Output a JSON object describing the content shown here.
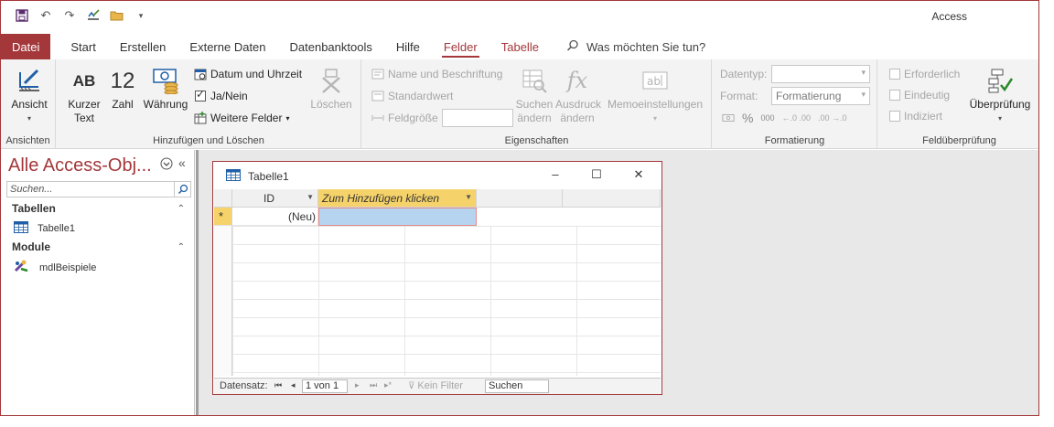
{
  "app": {
    "title": "Access"
  },
  "colors": {
    "accent": "#a4373a",
    "highlight_column": "#f6d36a",
    "selected_cell": "#b6d4f0"
  },
  "qat": {
    "icons": [
      "save-icon",
      "undo-icon",
      "redo-icon",
      "spelling-icon",
      "open-folder-icon",
      "customize-qat-icon"
    ]
  },
  "tabs": [
    {
      "label": "Datei"
    },
    {
      "label": "Start"
    },
    {
      "label": "Erstellen"
    },
    {
      "label": "Externe Daten"
    },
    {
      "label": "Datenbanktools"
    },
    {
      "label": "Hilfe"
    },
    {
      "label": "Felder"
    },
    {
      "label": "Tabelle"
    }
  ],
  "tellme": {
    "label": "Was möchten Sie tun?"
  },
  "ribbon": {
    "views": {
      "label": "Ansicht",
      "group": "Ansichten"
    },
    "add_delete": {
      "group": "Hinzufügen und Löschen",
      "short_text": "Kurzer Text",
      "short_text_icon": "AB",
      "number": "Zahl",
      "number_icon": "12",
      "currency": "Währung",
      "datetime": "Datum und Uhrzeit",
      "yesno": "Ja/Nein",
      "more_fields": "Weitere Felder",
      "delete": "Löschen"
    },
    "properties": {
      "group": "Eigenschaften",
      "name_caption": "Name und Beschriftung",
      "default_value": "Standardwert",
      "field_size": "Feldgröße",
      "lookups": "Suchen ändern",
      "expression": "Ausdruck ändern",
      "memo": "Memoeinstellungen"
    },
    "formatting": {
      "group": "Formatierung",
      "datatype_label": "Datentyp:",
      "format_label": "Format:",
      "format_value": "Formatierung",
      "percent": "%",
      "thousands": "000"
    },
    "validation": {
      "group": "Feldüberprüfung",
      "required": "Erforderlich",
      "unique": "Eindeutig",
      "indexed": "Indiziert",
      "validation": "Überprüfung"
    }
  },
  "nav": {
    "title": "Alle Access-Obj...",
    "search_placeholder": "Suchen...",
    "sections": [
      {
        "label": "Tabellen",
        "items": [
          {
            "label": "Tabelle1",
            "icon": "table-icon"
          }
        ]
      },
      {
        "label": "Module",
        "items": [
          {
            "label": "mdlBeispiele",
            "icon": "module-icon"
          }
        ]
      }
    ]
  },
  "table_window": {
    "title": "Tabelle1",
    "columns": [
      {
        "label": "ID"
      },
      {
        "label": "Zum Hinzufügen klicken"
      }
    ],
    "new_row": {
      "marker": "*",
      "id_value": "(Neu)"
    },
    "record_nav": {
      "label": "Datensatz:",
      "position": "1 von 1",
      "filter": "Kein Filter",
      "search": "Suchen"
    }
  }
}
